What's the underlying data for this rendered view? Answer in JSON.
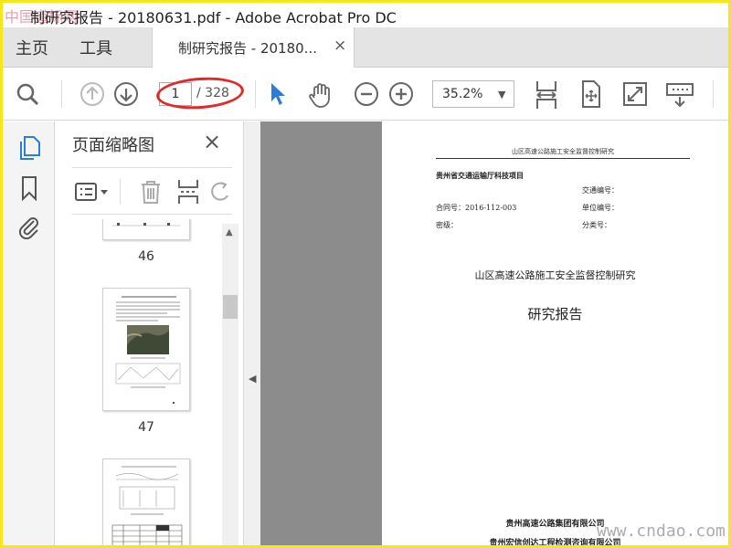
{
  "window": {
    "watermark_logo": "中国道标网",
    "title": "制研究报告 - 20180631.pdf - Adobe Acrobat Pro DC"
  },
  "tabs": {
    "home": "主页",
    "tools": "工具",
    "document_tab": "制研究报告 - 20180...",
    "close": "×"
  },
  "toolbar": {
    "current_page": "1",
    "total_pages": "/ 328",
    "zoom": "35.2%"
  },
  "thumbnails_panel": {
    "title": "页面缩略图",
    "close": "×",
    "pages": [
      {
        "number": "46"
      },
      {
        "number": "47"
      }
    ]
  },
  "document": {
    "header": "山区高速公路施工安全监督控制研究",
    "project_line": "贵州省交通运输厅科技项目",
    "fields": {
      "traffic_no": "交通编号：",
      "contract_no": "合同号：2016-112-003",
      "unit_code": "单位编号：",
      "secret_level": "密级：",
      "category_no": "分类号："
    },
    "title": "山区高速公路施工安全监督控制研究",
    "subtitle": "研究报告",
    "org1": "贵州高速公路集团有限公司",
    "org2": "贵州宏信创达工程检测咨询有限公司"
  },
  "site_watermark": "www.cndao.com",
  "colors": {
    "frame_border": "#f7e71a",
    "annotation_red": "#e02a2a",
    "select_blue": "#2d7dd2"
  }
}
